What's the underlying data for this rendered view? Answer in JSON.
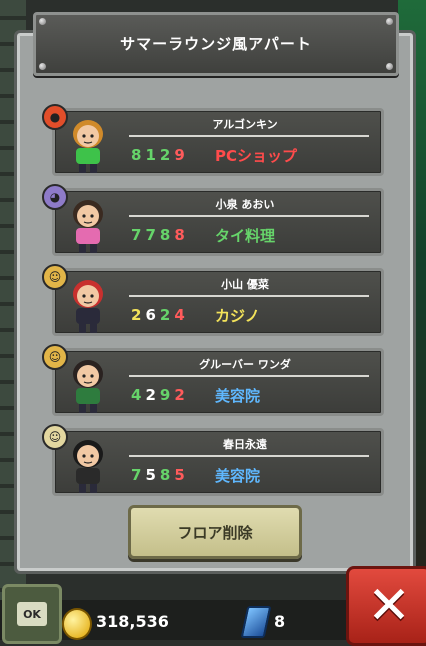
{
  "title": "サマーラウンジ風アパート",
  "colors": {
    "store_red": "#ff4b4b",
    "store_yellow": "#f3e35a",
    "store_blue": "#5fb8ff",
    "store_green": "#66d46a"
  },
  "residents": [
    {
      "name": "アルゴンキン",
      "digits": [
        "8",
        "1",
        "2",
        "9"
      ],
      "store": "PCショップ",
      "mood_icon": "angry-face-icon",
      "store_color": "red"
    },
    {
      "name": "小泉 あおい",
      "digits": [
        "7",
        "7",
        "8",
        "8"
      ],
      "store": "タイ料理",
      "mood_icon": "sad-face-icon",
      "store_color": "green"
    },
    {
      "name": "小山 優菜",
      "digits": [
        "2",
        "6",
        "2",
        "4"
      ],
      "store": "カジノ",
      "mood_icon": "happy-face-icon",
      "store_color": "yellow"
    },
    {
      "name": "グルーバー ワンダ",
      "digits": [
        "4",
        "2",
        "9",
        "2"
      ],
      "store": "美容院",
      "mood_icon": "happy-face-icon",
      "store_color": "blue"
    },
    {
      "name": "春日永遠",
      "digits": [
        "7",
        "5",
        "8",
        "5"
      ],
      "store": "美容院",
      "mood_icon": "neutral-face-icon",
      "store_color": "blue"
    }
  ],
  "floor_button": "フロア削除",
  "ok_label": "OK",
  "coins": "318,536",
  "gems": "8"
}
